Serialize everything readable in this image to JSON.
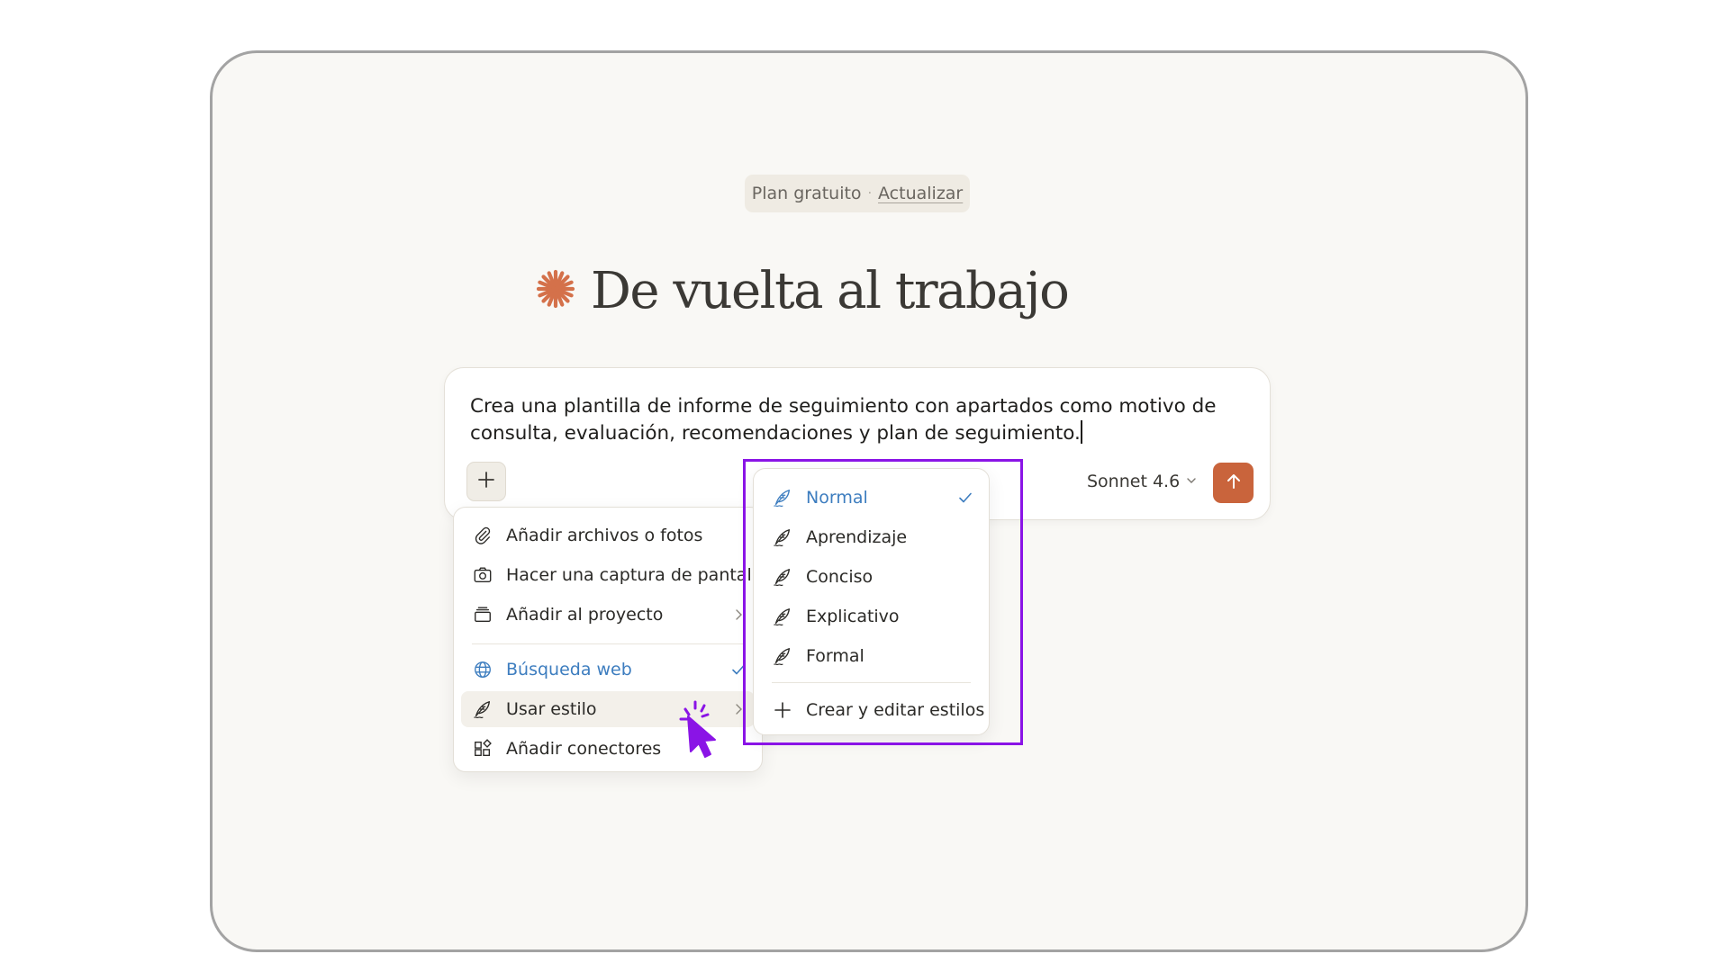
{
  "plan": {
    "label": "Plan gratuito",
    "separator": "·",
    "upgrade": "Actualizar"
  },
  "greeting": {
    "title": "De vuelta al trabajo"
  },
  "composer": {
    "prompt": "Crea una plantilla de informe de seguimiento con apartados como motivo de consulta, evaluación, recomendaciones y plan de seguimiento.",
    "model": "Sonnet 4.6"
  },
  "attach_menu": {
    "items": [
      {
        "label": "Añadir archivos o fotos",
        "icon": "paperclip-icon"
      },
      {
        "label": "Hacer una captura de pantalla",
        "icon": "camera-icon"
      },
      {
        "label": "Añadir al proyecto",
        "icon": "project-box-icon",
        "submenu": true
      },
      {
        "label": "Búsqueda web",
        "icon": "globe-icon",
        "checked": true
      },
      {
        "label": "Usar estilo",
        "icon": "quill-icon",
        "submenu": true,
        "hovered": true
      },
      {
        "label": "Añadir conectores",
        "icon": "connectors-icon"
      }
    ]
  },
  "style_menu": {
    "items": [
      {
        "label": "Normal",
        "icon": "quill-icon",
        "checked": true
      },
      {
        "label": "Aprendizaje",
        "icon": "quill-icon"
      },
      {
        "label": "Conciso",
        "icon": "quill-icon"
      },
      {
        "label": "Explicativo",
        "icon": "quill-icon"
      },
      {
        "label": "Formal",
        "icon": "quill-icon"
      }
    ],
    "create_label": "Crear y editar estilos"
  },
  "colors": {
    "accent": "#c9643c",
    "selected_blue": "#3d7dbf",
    "highlight_purple": "#8a14e6",
    "background": "#f9f8f5"
  }
}
